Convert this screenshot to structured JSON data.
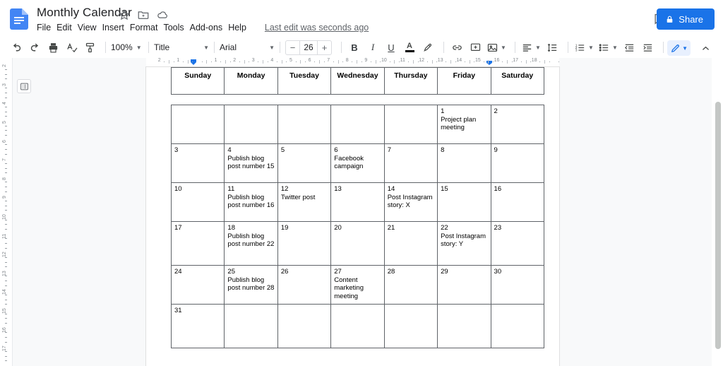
{
  "titlebar": {
    "doc_title": "Monthly Calendar",
    "icons": [
      {
        "name": "star-icon",
        "label": "Star"
      },
      {
        "name": "move-to-folder-icon",
        "label": "Move to folder"
      },
      {
        "name": "cloud-saved-icon",
        "label": "Saved to Drive"
      }
    ],
    "menus": [
      "File",
      "Edit",
      "View",
      "Insert",
      "Format",
      "Tools",
      "Add-ons",
      "Help"
    ],
    "last_edit": "Last edit was seconds ago",
    "comment_icon": "comment-history-icon",
    "share_label": "Share",
    "share_icon": "lock-icon",
    "share_color": "#1a73e8"
  },
  "toolbar": {
    "undo_icon": "undo-icon",
    "redo_icon": "redo-icon",
    "print_icon": "print-icon",
    "spellcheck_icon": "spellcheck-icon",
    "paint_format_icon": "paint-format-icon",
    "zoom_value": "100%",
    "style_value": "Title",
    "font_value": "Arial",
    "font_size_value": "26",
    "font_size_decrease": "−",
    "font_size_increase": "+",
    "bold_label": "B",
    "italic_label": "I",
    "underline_label": "U",
    "text_color_label": "A",
    "highlight_icon": "highlight-pen-icon",
    "link_icon": "insert-link-icon",
    "comment_add_icon": "add-comment-icon",
    "image_icon": "insert-image-icon",
    "align_icon": "align-left-icon",
    "line_spacing_icon": "line-spacing-icon",
    "numbered_list_icon": "numbered-list-icon",
    "bulleted_list_icon": "bulleted-list-icon",
    "indent_less_icon": "decrease-indent-icon",
    "indent_more_icon": "increase-indent-icon",
    "clear_format_icon": "clear-formatting-icon",
    "edit_mode_icon": "pencil-edit-icon",
    "collapse_icon": "chevron-up-icon"
  },
  "rulers": {
    "horizontal_ticks": [
      "2",
      "1",
      "1",
      "2",
      "3",
      "4",
      "5",
      "6",
      "7",
      "8",
      "9",
      "10",
      "11",
      "12",
      "13",
      "14",
      "15",
      "17",
      "18"
    ],
    "vertical_ticks": [
      "2",
      "3",
      "4",
      "5",
      "6",
      "7",
      "8",
      "9",
      "10",
      "11",
      "12",
      "13",
      "14",
      "15",
      "16",
      "17"
    ],
    "indent_marker_icon": "indent-marker-icon"
  },
  "outline_button_icon": "document-outline-icon",
  "calendar": {
    "day_headers": [
      "Sunday",
      "Monday",
      "Tuesday",
      "Wednesday",
      "Thursday",
      "Friday",
      "Saturday"
    ],
    "weeks": [
      [
        {
          "day": "",
          "event": ""
        },
        {
          "day": "",
          "event": ""
        },
        {
          "day": "",
          "event": ""
        },
        {
          "day": "",
          "event": ""
        },
        {
          "day": "",
          "event": ""
        },
        {
          "day": "1",
          "event": "Project plan meeting"
        },
        {
          "day": "2",
          "event": ""
        }
      ],
      [
        {
          "day": "3",
          "event": ""
        },
        {
          "day": "4",
          "event": "Publish blog post number 15"
        },
        {
          "day": "5",
          "event": ""
        },
        {
          "day": "6",
          "event": "Facebook campaign"
        },
        {
          "day": "7",
          "event": ""
        },
        {
          "day": "8",
          "event": ""
        },
        {
          "day": "9",
          "event": ""
        }
      ],
      [
        {
          "day": "10",
          "event": ""
        },
        {
          "day": "11",
          "event": "Publish blog post number 16"
        },
        {
          "day": "12",
          "event": "Twitter post"
        },
        {
          "day": "13",
          "event": ""
        },
        {
          "day": "14",
          "event": "Post Instagram story: X"
        },
        {
          "day": "15",
          "event": ""
        },
        {
          "day": "16",
          "event": ""
        }
      ],
      [
        {
          "day": "17",
          "event": ""
        },
        {
          "day": "18",
          "event": "Publish blog post number 22"
        },
        {
          "day": "19",
          "event": ""
        },
        {
          "day": "20",
          "event": ""
        },
        {
          "day": "21",
          "event": ""
        },
        {
          "day": "22",
          "event": "Post Instagram story: Y"
        },
        {
          "day": "23",
          "event": ""
        }
      ],
      [
        {
          "day": "24",
          "event": ""
        },
        {
          "day": "25",
          "event": "Publish blog post number 28"
        },
        {
          "day": "26",
          "event": ""
        },
        {
          "day": "27",
          "event": "Content marketing meeting"
        },
        {
          "day": "28",
          "event": ""
        },
        {
          "day": "29",
          "event": ""
        },
        {
          "day": "30",
          "event": ""
        }
      ],
      [
        {
          "day": "31",
          "event": ""
        },
        {
          "day": "",
          "event": ""
        },
        {
          "day": "",
          "event": ""
        },
        {
          "day": "",
          "event": ""
        },
        {
          "day": "",
          "event": ""
        },
        {
          "day": "",
          "event": ""
        },
        {
          "day": "",
          "event": ""
        }
      ]
    ]
  }
}
